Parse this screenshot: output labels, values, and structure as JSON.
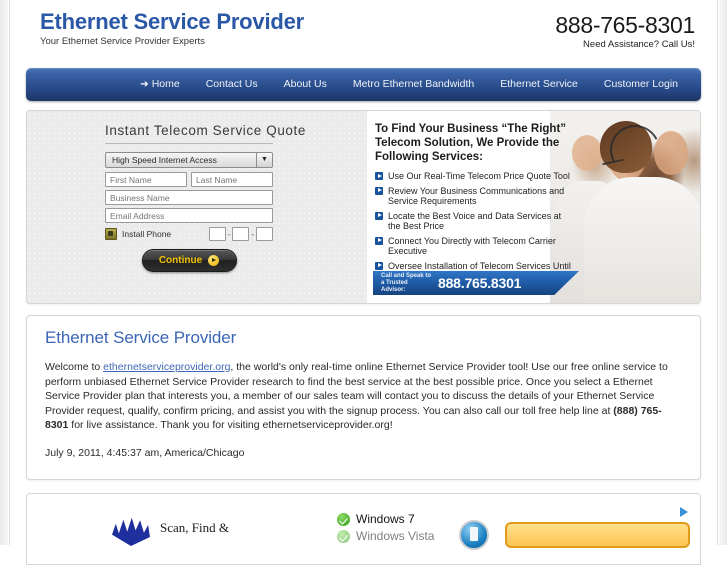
{
  "header": {
    "logo_title": "Ethernet Service Provider",
    "logo_tagline": "Your Ethernet Service Provider Experts",
    "phone_number": "888-765-8301",
    "phone_caption": "Need Assistance? Call Us!"
  },
  "nav": {
    "items": [
      {
        "label": "Home",
        "active": true
      },
      {
        "label": "Contact Us",
        "active": false
      },
      {
        "label": "About Us",
        "active": false
      },
      {
        "label": "Metro Ethernet Bandwidth",
        "active": false
      },
      {
        "label": "Ethernet Service",
        "active": false
      },
      {
        "label": "Customer Login",
        "active": false
      }
    ]
  },
  "quote_form": {
    "title": "Instant Telecom Service Quote",
    "service_select_value": "High Speed Internet Access",
    "first_name_placeholder": "First Name",
    "last_name_placeholder": "Last Name",
    "business_name_placeholder": "Business Name",
    "email_placeholder": "Email Address",
    "install_phone_label": "Install Phone",
    "phone_part_1": "",
    "phone_part_2": "",
    "phone_part_3": "",
    "phone_separator": "-",
    "continue_label": "Continue"
  },
  "promo": {
    "heading": "To Find Your Business “The Right” Telecom Solution, We Provide the Following Services:",
    "services": [
      "Use Our Real-Time Telecom Price Quote Tool",
      "Review Your Business Communications and Service Requirements",
      "Locate the Best Voice and Data Services at the Best Price",
      "Connect You Directly with Telecom Carrier Executive",
      "Oversee Installation of Telecom Services Until Desired Result is Achieved"
    ],
    "call_banner_label": "Call and Speak to a Trusted Advisor:",
    "call_banner_number": "888.765.8301"
  },
  "article": {
    "title": "Ethernet Service Provider",
    "body_1": "Welcome to ",
    "link_text": "ethernetserviceprovider.org",
    "body_2": ", the world's only real-time online Ethernet Service Provider tool! Use our free online service to perform unbiased Ethernet Service Provider research to find the best service at the best possible price. Once you select a Ethernet Service Provider plan that interests you, a member of our sales team will contact you to discuss the details of your Ethernet Service Provider request, qualify, confirm pricing, and assist you with the signup process. You can also call our toll free help line at ",
    "body_phone": "(888) 765-8301",
    "body_3": " for live assistance. Thank you for visiting ethernetserviceprovider.org!",
    "timestamp": "July 9, 2011, 4:45:37 am, America/Chicago"
  },
  "ad": {
    "headline": "Scan, Find &",
    "checklist": [
      "Windows 7",
      "Windows Vista"
    ],
    "adchoices_label": ""
  },
  "colors": {
    "brand_blue": "#2b58a6",
    "nav_blue": "#2b4f8f",
    "link_blue": "#3b66b5",
    "accent_yellow": "#f2c200",
    "bullet_blue": "#18539e"
  }
}
